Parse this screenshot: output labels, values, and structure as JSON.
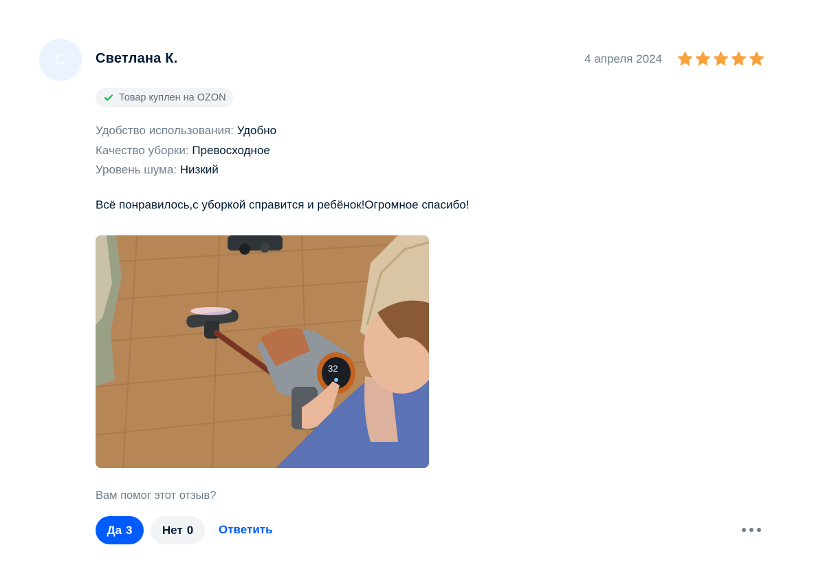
{
  "review": {
    "avatar_letter": "С",
    "author": "Светлана К.",
    "date": "4 апреля 2024",
    "rating": 5,
    "star_color": "#f9a23b",
    "badge": {
      "icon": "check-icon",
      "text": "Товар куплен на OZON",
      "icon_color": "#10c44c"
    },
    "params": [
      {
        "name": "Удобство использования:",
        "value": "Удобно"
      },
      {
        "name": "Качество уборки:",
        "value": "Превосходное"
      },
      {
        "name": "Уровень шума:",
        "value": "Низкий"
      }
    ],
    "text": "Всё понравилось,с уборкой справится и ребёнок!Огромное спасибо!",
    "photo": {
      "display_value": "32"
    }
  },
  "feedback": {
    "question": "Вам помог этот отзыв?",
    "yes_label": "Да",
    "yes_count": "3",
    "no_label": "Нет",
    "no_count": "0",
    "reply_label": "Ответить",
    "more_icon": "more-dots-icon"
  },
  "colors": {
    "accent": "#005bff",
    "text_primary": "#001a34",
    "text_secondary": "#707f8d"
  }
}
